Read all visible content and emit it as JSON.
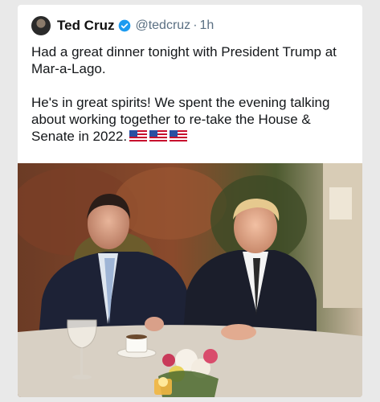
{
  "author": {
    "name": "Ted Cruz",
    "handle": "@tedcruz",
    "separator": "·",
    "time": "1h"
  },
  "tweet": {
    "paragraph_1": "Had a great dinner tonight with President Trump at Mar-a-Lago.",
    "paragraph_2": "He's in great spirits! We spent the evening talking about working together to re-take the House & Senate in 2022.",
    "emoji": [
      "us-flag-emoji",
      "us-flag-emoji",
      "us-flag-emoji"
    ]
  },
  "colors": {
    "verified": "#1d9bf0",
    "handle_gray": "#5b7083"
  }
}
